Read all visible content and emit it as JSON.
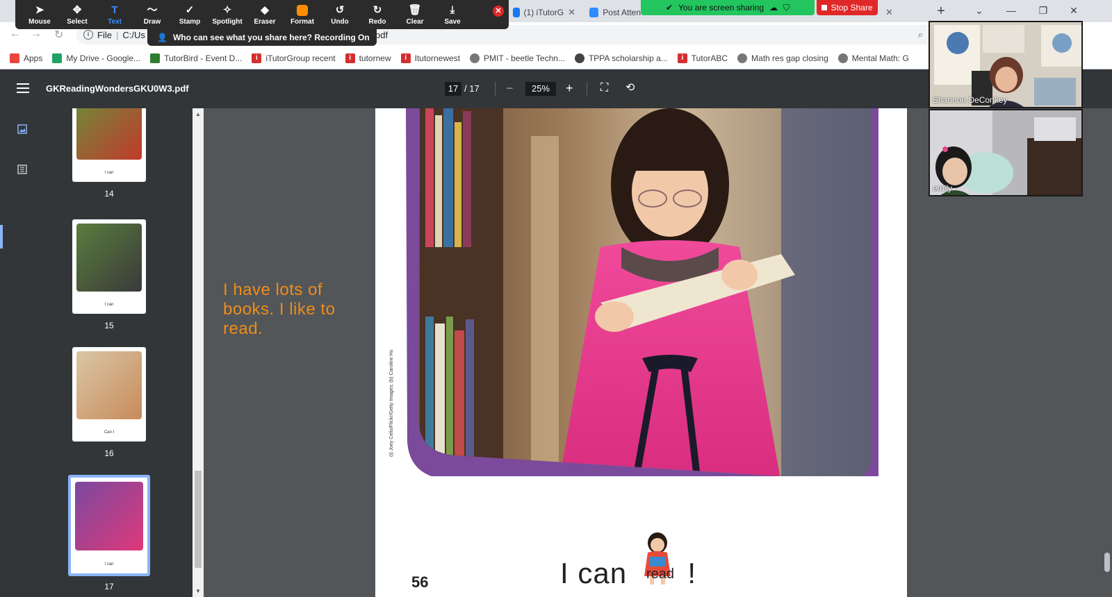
{
  "browser": {
    "tabs": [
      {
        "label": "(1) iTutorG",
        "icon_color": "#1877f2"
      },
      {
        "label": "Post Atten",
        "icon_color": "#2d8cff"
      }
    ],
    "address_prefix": "File",
    "address_text": "C:/Us",
    "address_suffix": "pdf",
    "bookmarks": [
      {
        "label": "Apps",
        "icon": "apps-icon",
        "color": "#e8453c"
      },
      {
        "label": "My Drive - Google...",
        "icon": "drive-icon",
        "color": "#1fa463"
      },
      {
        "label": "TutorBird - Event D...",
        "icon": "tutorbird-icon",
        "color": "#2e7d32"
      },
      {
        "label": "iTutorGroup recent",
        "icon": "itutor-icon",
        "color": "#d32f2f"
      },
      {
        "label": "tutornew",
        "icon": "itutor-icon",
        "color": "#d32f2f"
      },
      {
        "label": "Itutornewest",
        "icon": "itutor-icon",
        "color": "#d32f2f"
      },
      {
        "label": "PMIT - beetle Techn...",
        "icon": "globe-icon",
        "color": "#777777"
      },
      {
        "label": "TPPA scholarship a...",
        "icon": "tppa-icon",
        "color": "#444444"
      },
      {
        "label": "TutorABC",
        "icon": "itutor-icon",
        "color": "#d32f2f"
      },
      {
        "label": "Math res gap closing",
        "icon": "globe-icon",
        "color": "#777777"
      },
      {
        "label": "Mental Math: G",
        "icon": "globe-icon",
        "color": "#777777"
      }
    ]
  },
  "annotate": {
    "tools": [
      {
        "label": "Mouse",
        "glyph": "➤",
        "name": "mouse"
      },
      {
        "label": "Select",
        "glyph": "✥",
        "name": "select"
      },
      {
        "label": "Text",
        "glyph": "T",
        "name": "text"
      },
      {
        "label": "Draw",
        "glyph": "〜",
        "name": "draw"
      },
      {
        "label": "Stamp",
        "glyph": "✓",
        "name": "stamp"
      },
      {
        "label": "Spotlight",
        "glyph": "✧",
        "name": "spotlight"
      },
      {
        "label": "Eraser",
        "glyph": "◆",
        "name": "eraser"
      },
      {
        "label": "Format",
        "glyph": "",
        "name": "format"
      },
      {
        "label": "Undo",
        "glyph": "↺",
        "name": "undo"
      },
      {
        "label": "Redo",
        "glyph": "↻",
        "name": "redo"
      },
      {
        "label": "Clear",
        "glyph": "🗑",
        "name": "clear"
      },
      {
        "label": "Save",
        "glyph": "⤓",
        "name": "save"
      }
    ],
    "active_tool": "Text",
    "recording_notice": "Who can see what you share here? Recording On"
  },
  "share": {
    "status": "You are screen sharing",
    "stop_label": "Stop Share"
  },
  "pdf": {
    "filename": "GKReadingWondersGKU0W3.pdf",
    "current_page": "17",
    "total_pages": "/ 17",
    "zoom": "25%",
    "thumbnails": [
      {
        "page": "14",
        "caption": "I can",
        "colors": [
          "#6a8f3a",
          "#c23a2c"
        ]
      },
      {
        "page": "15",
        "caption": "I can",
        "colors": [
          "#5a7d3e",
          "#3a3a3a"
        ]
      },
      {
        "page": "16",
        "caption": "Can I",
        "colors": [
          "#d9c7a6",
          "#c88a5a"
        ]
      },
      {
        "page": "17",
        "caption": "I can",
        "colors": [
          "#7a4a9e",
          "#e0387a"
        ]
      }
    ]
  },
  "document": {
    "side_note": "I have lots of books.  I like to read.",
    "caption_text": "I can",
    "caption_punct": "!",
    "rebus_word": "read",
    "page_number": "56",
    "photo_credit": "(t) Joey Celis/Flickr/Getty Images; (b) Caroline Hu"
  },
  "participants": [
    {
      "name": "Shannon DeConkey"
    },
    {
      "name": "emily"
    }
  ]
}
